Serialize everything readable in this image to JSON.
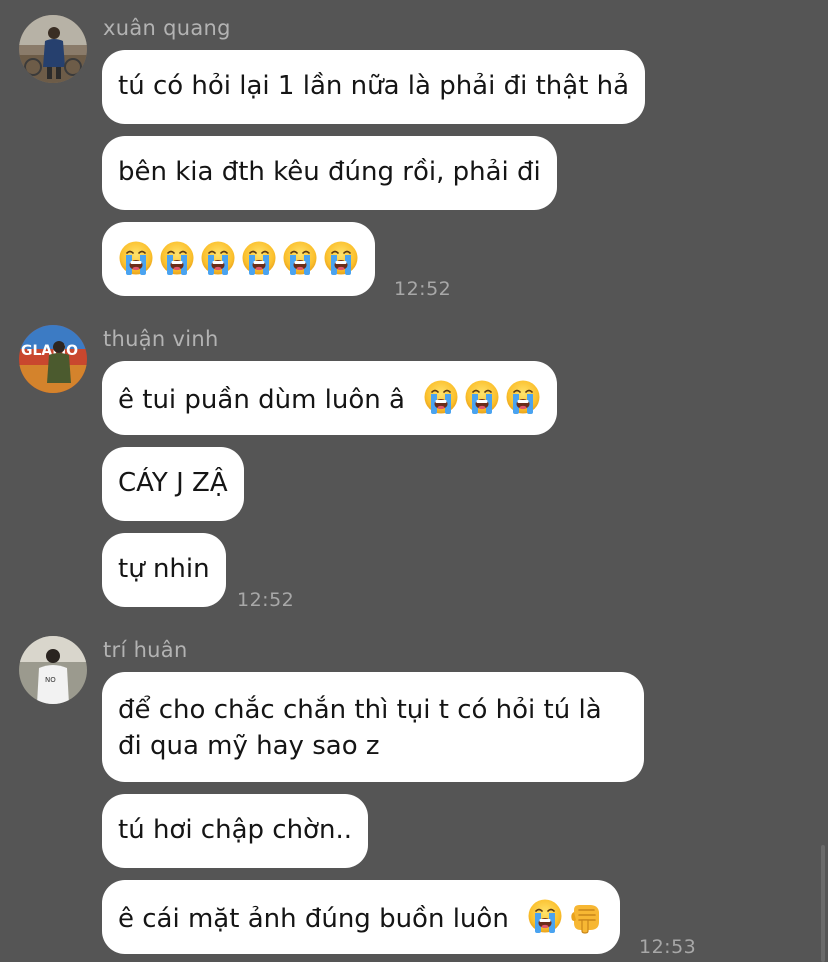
{
  "colors": {
    "background": "#555555",
    "bubble": "#ffffff",
    "text": "#151515",
    "meta": "#a8a8a8"
  },
  "groups": [
    {
      "sender": "xuân quang",
      "time": "12:52",
      "messages": [
        {
          "text": "tú có hỏi lại 1 lần nữa là phải đi thật hả"
        },
        {
          "text": "bên kia đth kêu đúng rồi, phải đi"
        },
        {
          "text": "",
          "emojis": [
            "loudly-crying-face",
            "loudly-crying-face",
            "loudly-crying-face",
            "loudly-crying-face",
            "loudly-crying-face",
            "loudly-crying-face"
          ]
        }
      ]
    },
    {
      "sender": "thuận vinh",
      "time": "12:52",
      "messages": [
        {
          "text": "ê tui puần dùm luôn â",
          "emojis": [
            "loudly-crying-face",
            "loudly-crying-face",
            "loudly-crying-face"
          ]
        },
        {
          "text": "CÁY J ZẬ"
        },
        {
          "text": "tự nhin"
        }
      ]
    },
    {
      "sender": "trí huân",
      "time": "12:53",
      "messages": [
        {
          "text": "để cho chắc chắn thì tụi t có hỏi tú là đi qua mỹ hay sao z"
        },
        {
          "text": "tú hơi chập chờn.."
        },
        {
          "text": "ê cái mặt ảnh đúng buồn luôn",
          "emojis": [
            "loudly-crying-face",
            "backhand-index-pointing-down"
          ]
        }
      ]
    }
  ]
}
